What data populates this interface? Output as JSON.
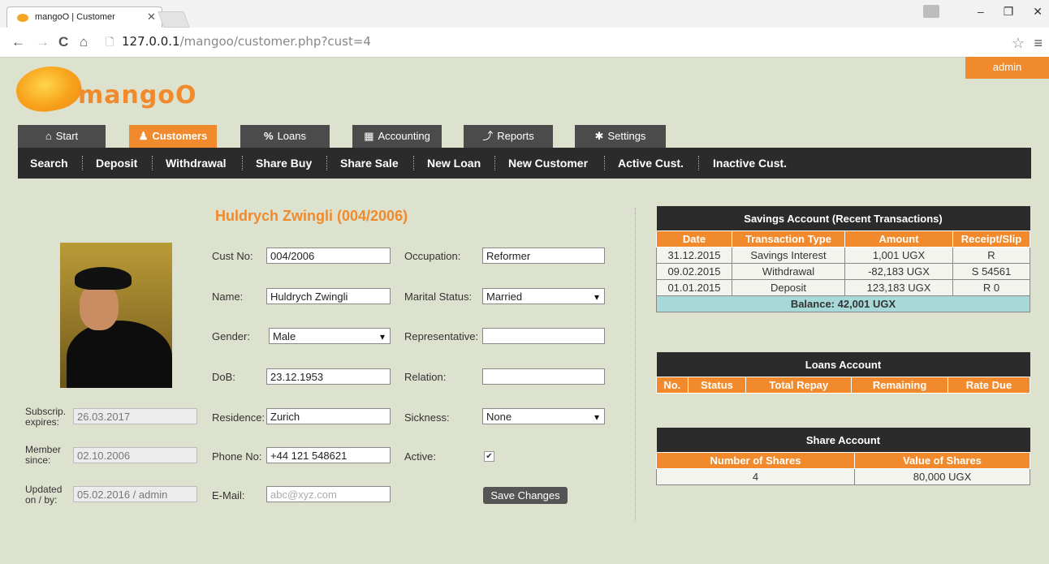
{
  "browser": {
    "tab_title": "mangoO | Customer",
    "url_host": "127.0.0.1",
    "url_path": "/mangoo/customer.php?cust=4"
  },
  "header": {
    "user": "admin",
    "logo_text": "mangoO"
  },
  "main_tabs": [
    {
      "label": "Start",
      "icon": "home-icon"
    },
    {
      "label": "Customers",
      "icon": "user-icon"
    },
    {
      "label": "Loans",
      "icon": "percent-icon"
    },
    {
      "label": "Accounting",
      "icon": "calculator-icon"
    },
    {
      "label": "Reports",
      "icon": "chart-icon"
    },
    {
      "label": "Settings",
      "icon": "gear-icon"
    }
  ],
  "sub_nav": [
    "Search",
    "Deposit",
    "Withdrawal",
    "Share Buy",
    "Share Sale",
    "New Loan",
    "New Customer",
    "Active Cust.",
    "Inactive Cust."
  ],
  "customer": {
    "heading": "Huldrych Zwingli (004/2006)",
    "meta": {
      "subscrip_label": "Subscrip. expires:",
      "subscrip_value": "26.03.2017",
      "member_label": "Member since:",
      "member_value": "02.10.2006",
      "updated_label": "Updated on / by:",
      "updated_value": "05.02.2016 / admin"
    },
    "fields": {
      "cust_no_label": "Cust No:",
      "cust_no": "004/2006",
      "name_label": "Name:",
      "name": "Huldrych Zwingli",
      "gender_label": "Gender:",
      "gender": "Male",
      "dob_label": "DoB:",
      "dob": "23.12.1953",
      "residence_label": "Residence:",
      "residence": "Zurich",
      "phone_label": "Phone No:",
      "phone": "+44 121 548621",
      "email_label": "E-Mail:",
      "email_placeholder": "abc@xyz.com",
      "occupation_label": "Occupation:",
      "occupation": "Reformer",
      "marital_label": "Marital Status:",
      "marital": "Married",
      "representative_label": "Representative:",
      "representative": "",
      "relation_label": "Relation:",
      "relation": "",
      "sickness_label": "Sickness:",
      "sickness": "None",
      "active_label": "Active:",
      "active": true
    },
    "save_label": "Save Changes"
  },
  "savings": {
    "title": "Savings Account (Recent Transactions)",
    "headers": [
      "Date",
      "Transaction Type",
      "Amount",
      "Receipt/Slip"
    ],
    "rows": [
      [
        "31.12.2015",
        "Savings Interest",
        "1,001 UGX",
        "R"
      ],
      [
        "09.02.2015",
        "Withdrawal",
        "-82,183 UGX",
        "S 54561"
      ],
      [
        "01.01.2015",
        "Deposit",
        "123,183 UGX",
        "R 0"
      ]
    ],
    "balance": "Balance: 42,001 UGX"
  },
  "loans": {
    "title": "Loans Account",
    "headers": [
      "No.",
      "Status",
      "Total Repay",
      "Remaining",
      "Rate Due"
    ]
  },
  "shares": {
    "title": "Share Account",
    "headers": [
      "Number of Shares",
      "Value of Shares"
    ],
    "row": [
      "4",
      "80,000 UGX"
    ]
  }
}
